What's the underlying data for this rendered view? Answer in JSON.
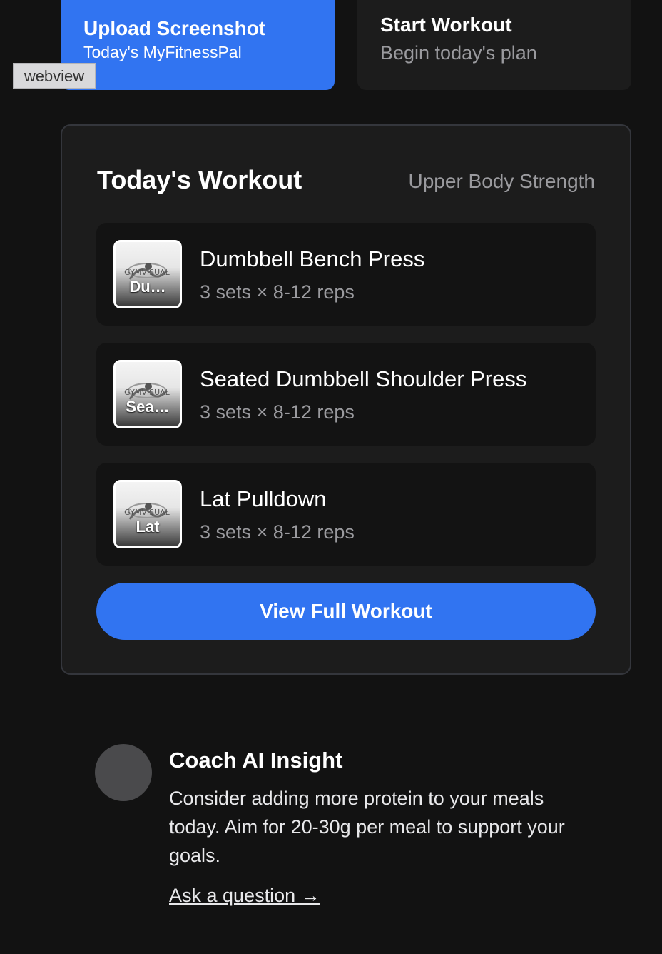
{
  "actions": {
    "upload": {
      "title": "Upload Screenshot",
      "subtitle": "Today's MyFitnessPal"
    },
    "start": {
      "title": "Start Workout",
      "subtitle": "Begin today's plan"
    },
    "webview_label": "webview"
  },
  "workout": {
    "title": "Today's Workout",
    "subtitle": "Upper Body Strength",
    "exercises": [
      {
        "name": "Dumbbell Bench Press",
        "detail": "3 sets × 8-12 reps",
        "thumb_label": "Du…",
        "thumb_logo": "GYMVISUAL"
      },
      {
        "name": "Seated Dumbbell Shoulder Press",
        "detail": "3 sets × 8-12 reps",
        "thumb_label": "Sea…",
        "thumb_logo": "GYMVISUAL"
      },
      {
        "name": "Lat Pulldown",
        "detail": "3 sets × 8-12 reps",
        "thumb_label": "Lat",
        "thumb_logo": "GYMVISUAL"
      }
    ],
    "view_button": "View Full Workout"
  },
  "coach": {
    "title": "Coach AI Insight",
    "message": "Consider adding more protein to your meals today. Aim for 20-30g per meal to support your goals.",
    "link": "Ask a question →"
  },
  "colors": {
    "accent": "#3174f1",
    "background": "#121212",
    "card": "#1c1c1c",
    "muted_text": "#9a9a9e"
  }
}
